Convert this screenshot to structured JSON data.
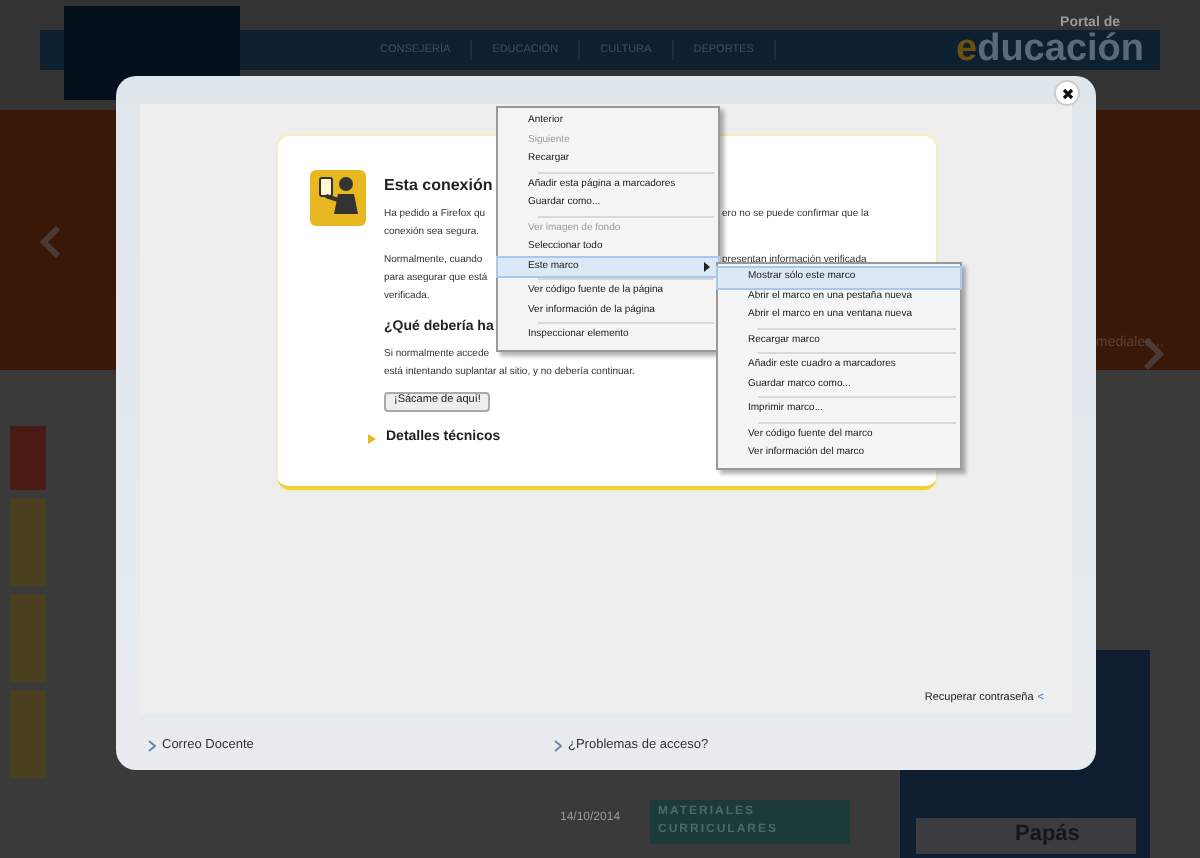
{
  "background_page": {
    "portal_label": "Portal de",
    "portal_logo_first": "e",
    "portal_logo_rest": "ducación",
    "nav": [
      "CONSEJERÍA",
      "EDUCACIÓN",
      "CULTURA",
      "DEPORTES"
    ],
    "banner_caption": "mediales...",
    "promo_banner": "MATERIALES CURRICULARES",
    "promo_date": "14/10/2014",
    "papas_banner": "Papás",
    "side_tabs": [
      {
        "selected": true
      },
      {
        "selected": false
      },
      {
        "selected": false
      },
      {
        "selected": false
      }
    ]
  },
  "modal": {
    "error_page": {
      "title": "Esta conexión",
      "paragraphs": [
        [
          {
            "left": "Ha pedido a Firefox qu",
            "right": "ero no se puede confirmar que la"
          },
          {
            "left": "conexión sea segura."
          }
        ],
        [
          {
            "left": "Normalmente, cuando",
            "right": "presentan información verificada"
          },
          {
            "left": "para asegurar que está"
          },
          {
            "left": "verificada."
          }
        ]
      ],
      "subtitle": "¿Qué debería ha",
      "lines2": [
        {
          "left": "Si normalmente accede"
        },
        {
          "left": "está intentando suplantar al sitio, y no debería continuar."
        }
      ],
      "button": "¡Sácame de aquí!",
      "details": "Detalles técnicos"
    },
    "recover_link": "Recuperar contraseña",
    "recover_chevron": "<",
    "footer_links": [
      "Correo Docente",
      "¿Problemas de acceso?"
    ]
  },
  "context_menu": [
    {
      "kind": "item",
      "label": "Anterior",
      "disabled": false,
      "highlighted": false,
      "submenu": false
    },
    {
      "kind": "item",
      "label": "Siguiente",
      "disabled": true,
      "highlighted": false,
      "submenu": false
    },
    {
      "kind": "item",
      "label": "Recargar",
      "disabled": false,
      "highlighted": false,
      "submenu": false
    },
    {
      "kind": "separator"
    },
    {
      "kind": "item",
      "label": "Añadir esta página a marcadores",
      "disabled": false,
      "highlighted": false,
      "submenu": false
    },
    {
      "kind": "item",
      "label": "Guardar como...",
      "disabled": false,
      "highlighted": false,
      "submenu": false
    },
    {
      "kind": "separator"
    },
    {
      "kind": "item",
      "label": "Ver imagen de fondo",
      "disabled": true,
      "highlighted": false,
      "submenu": false
    },
    {
      "kind": "item",
      "label": "Seleccionar todo",
      "disabled": false,
      "highlighted": false,
      "submenu": false
    },
    {
      "kind": "item",
      "label": "Este marco",
      "disabled": false,
      "highlighted": true,
      "submenu": true
    },
    {
      "kind": "separator"
    },
    {
      "kind": "item",
      "label": "Ver código fuente de la página",
      "disabled": false,
      "highlighted": false,
      "submenu": false
    },
    {
      "kind": "item",
      "label": "Ver información de la página",
      "disabled": false,
      "highlighted": false,
      "submenu": false
    },
    {
      "kind": "separator"
    },
    {
      "kind": "item",
      "label": "Inspeccionar elemento",
      "disabled": false,
      "highlighted": false,
      "submenu": false
    }
  ],
  "frame_submenu": [
    {
      "kind": "item",
      "label": "Mostrar sólo este marco",
      "disabled": false,
      "highlighted": true,
      "submenu": false
    },
    {
      "kind": "item",
      "label": "Abrir el marco en una pestaña nueva",
      "disabled": false,
      "highlighted": false,
      "submenu": false
    },
    {
      "kind": "item",
      "label": "Abrir el marco en una ventana nueva",
      "disabled": false,
      "highlighted": false,
      "submenu": false
    },
    {
      "kind": "separator"
    },
    {
      "kind": "item",
      "label": "Recargar marco",
      "disabled": false,
      "highlighted": false,
      "submenu": false
    },
    {
      "kind": "separator"
    },
    {
      "kind": "item",
      "label": "Añadir este cuadro a marcadores",
      "disabled": false,
      "highlighted": false,
      "submenu": false
    },
    {
      "kind": "item",
      "label": "Guardar marco como...",
      "disabled": false,
      "highlighted": false,
      "submenu": false
    },
    {
      "kind": "separator"
    },
    {
      "kind": "item",
      "label": "Imprimir marco...",
      "disabled": false,
      "highlighted": false,
      "submenu": false
    },
    {
      "kind": "separator"
    },
    {
      "kind": "item",
      "label": "Ver código fuente del marco",
      "disabled": false,
      "highlighted": false,
      "submenu": false
    },
    {
      "kind": "item",
      "label": "Ver información del marco",
      "disabled": false,
      "highlighted": false,
      "submenu": false
    }
  ]
}
